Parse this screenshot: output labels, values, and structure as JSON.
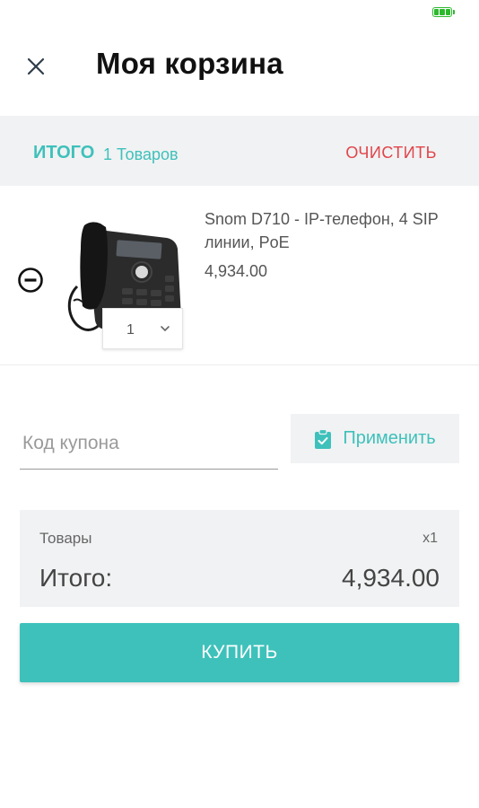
{
  "header": {
    "title": "Моя корзина",
    "close_icon": "close-icon"
  },
  "summary": {
    "total_label": "ИТОГО",
    "count_label": "1 Товаров",
    "clear_label": "ОЧИСТИТЬ"
  },
  "cart": {
    "items": [
      {
        "name": "Snom D710 - IP-телефон, 4 SIP линии, PoE",
        "price": "4,934.00",
        "quantity": "1",
        "image": "ip-phone-image"
      }
    ]
  },
  "coupon": {
    "placeholder": "Код купона",
    "value": "",
    "apply_label": "Применить",
    "apply_icon": "clipboard-check-icon"
  },
  "totals": {
    "items_label": "Товары",
    "items_qty": "x1",
    "total_label": "Итого:",
    "total_value": "4,934.00"
  },
  "actions": {
    "buy_label": "КУПИТЬ"
  },
  "colors": {
    "accent": "#3ec1bb",
    "danger": "#e0454b",
    "panel": "#f1f2f3"
  }
}
